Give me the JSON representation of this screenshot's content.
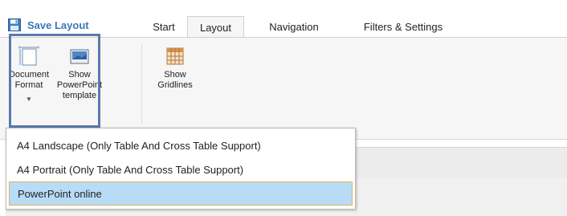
{
  "header": {
    "save_layout": {
      "label": "Save Layout",
      "icon": "floppy-disk-icon"
    }
  },
  "tabs": [
    {
      "label": "Start",
      "active": false
    },
    {
      "label": "Layout",
      "active": true
    },
    {
      "label": "Navigation",
      "active": false
    },
    {
      "label": "Filters & Settings",
      "active": false
    }
  ],
  "ribbon": {
    "document_format": {
      "line1": "Document",
      "line2": "Format",
      "icon": "document-format-icon",
      "has_dropdown": true
    },
    "show_powerpoint": {
      "line1": "Show",
      "line2": "PowerPoint",
      "line3": "template",
      "icon": "powerpoint-template-icon"
    },
    "show_gridlines": {
      "line1": "Show",
      "line2": "Gridlines",
      "icon": "gridlines-icon"
    }
  },
  "dropdown": {
    "items": [
      {
        "label": "A4 Landscape (Only Table And Cross Table Support)",
        "selected": false
      },
      {
        "label": "A4 Portrait (Only Table And Cross Table Support)",
        "selected": false
      },
      {
        "label": "PowerPoint online",
        "selected": true
      }
    ]
  },
  "colors": {
    "accent": "#3a78b8",
    "highlight_border": "#5a79ad",
    "selected_bg": "#b9dcf6",
    "selected_border": "#e0b25b"
  }
}
